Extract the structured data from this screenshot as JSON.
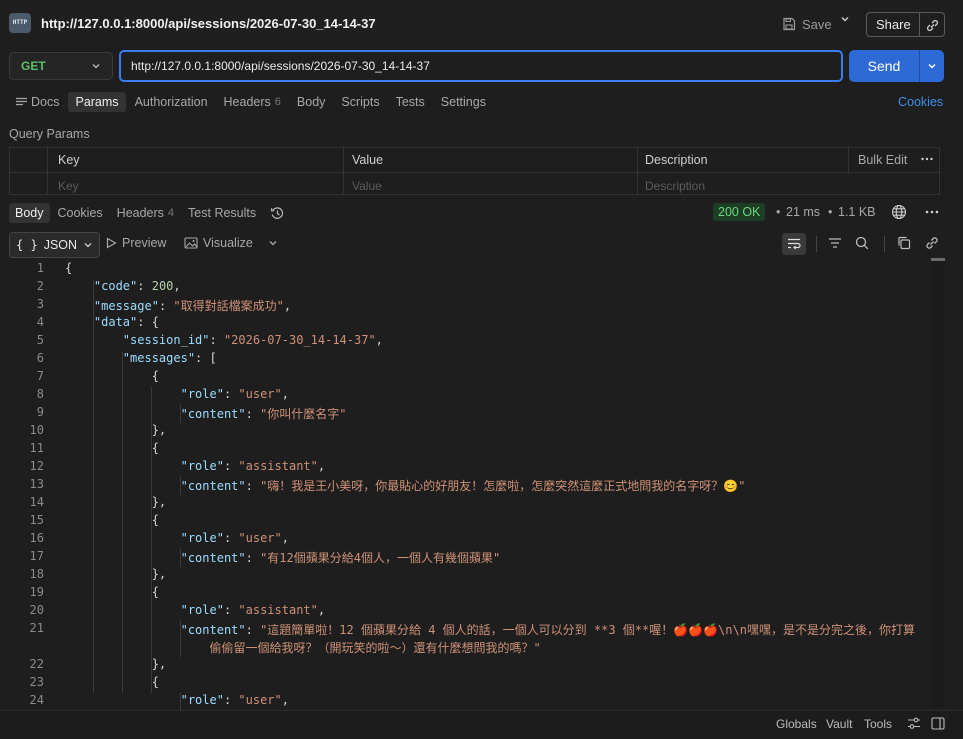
{
  "header": {
    "request_title": "http://127.0.0.1:8000/api/sessions/2026-07-30_14-14-37",
    "http_badge": "HTTP",
    "save_label": "Save",
    "share_label": "Share"
  },
  "request": {
    "method": "GET",
    "url": "http://127.0.0.1:8000/api/sessions/2026-07-30_14-14-37",
    "send_label": "Send",
    "tabs": [
      {
        "label": "Docs"
      },
      {
        "label": "Params"
      },
      {
        "label": "Authorization"
      },
      {
        "label": "Headers",
        "count": "6"
      },
      {
        "label": "Body"
      },
      {
        "label": "Scripts"
      },
      {
        "label": "Tests"
      },
      {
        "label": "Settings"
      }
    ],
    "active_tab": "Params",
    "cookies_label": "Cookies",
    "query_params_title": "Query Params",
    "table": {
      "headers": [
        "Key",
        "Value",
        "Description"
      ],
      "bulk_edit": "Bulk Edit",
      "placeholders": [
        "Key",
        "Value",
        "Description"
      ]
    }
  },
  "response": {
    "tabs": [
      {
        "label": "Body"
      },
      {
        "label": "Cookies"
      },
      {
        "label": "Headers",
        "count": "4"
      },
      {
        "label": "Test Results"
      }
    ],
    "active_tab": "Body",
    "status": "200 OK",
    "time": "21 ms",
    "size": "1.1 KB",
    "format": "JSON",
    "preview_label": "Preview",
    "visualize_label": "Visualize",
    "lines": [
      {
        "n": "1",
        "t": [
          [
            "p",
            "{"
          ]
        ]
      },
      {
        "n": "2",
        "t": [
          [
            "p",
            "    "
          ],
          [
            "k",
            "\"code\""
          ],
          [
            "p",
            ": "
          ],
          [
            "n",
            "200"
          ],
          [
            "p",
            ","
          ]
        ]
      },
      {
        "n": "3",
        "t": [
          [
            "p",
            "    "
          ],
          [
            "k",
            "\"message\""
          ],
          [
            "p",
            ": "
          ],
          [
            "s",
            "\"取得對話檔案成功\""
          ],
          [
            "p",
            ","
          ]
        ]
      },
      {
        "n": "4",
        "t": [
          [
            "p",
            "    "
          ],
          [
            "k",
            "\"data\""
          ],
          [
            "p",
            ": {"
          ]
        ]
      },
      {
        "n": "5",
        "t": [
          [
            "p",
            "        "
          ],
          [
            "k",
            "\"session_id\""
          ],
          [
            "p",
            ": "
          ],
          [
            "s",
            "\"2026-07-30_14-14-37\""
          ],
          [
            "p",
            ","
          ]
        ]
      },
      {
        "n": "6",
        "t": [
          [
            "p",
            "        "
          ],
          [
            "k",
            "\"messages\""
          ],
          [
            "p",
            ": ["
          ]
        ]
      },
      {
        "n": "7",
        "t": [
          [
            "p",
            "            {"
          ]
        ]
      },
      {
        "n": "8",
        "t": [
          [
            "p",
            "                "
          ],
          [
            "k",
            "\"role\""
          ],
          [
            "p",
            ": "
          ],
          [
            "s",
            "\"user\""
          ],
          [
            "p",
            ","
          ]
        ]
      },
      {
        "n": "9",
        "t": [
          [
            "p",
            "                "
          ],
          [
            "k",
            "\"content\""
          ],
          [
            "p",
            ": "
          ],
          [
            "s",
            "\"你叫什麼名字\""
          ]
        ]
      },
      {
        "n": "10",
        "t": [
          [
            "p",
            "            },"
          ]
        ]
      },
      {
        "n": "11",
        "t": [
          [
            "p",
            "            {"
          ]
        ]
      },
      {
        "n": "12",
        "t": [
          [
            "p",
            "                "
          ],
          [
            "k",
            "\"role\""
          ],
          [
            "p",
            ": "
          ],
          [
            "s",
            "\"assistant\""
          ],
          [
            "p",
            ","
          ]
        ]
      },
      {
        "n": "13",
        "t": [
          [
            "p",
            "                "
          ],
          [
            "k",
            "\"content\""
          ],
          [
            "p",
            ": "
          ],
          [
            "s",
            "\"嗨！我是王小美呀，你最貼心的好朋友！怎麼啦，怎麼突然這麼正式地問我的名字呀？😊\""
          ]
        ]
      },
      {
        "n": "14",
        "t": [
          [
            "p",
            "            },"
          ]
        ]
      },
      {
        "n": "15",
        "t": [
          [
            "p",
            "            {"
          ]
        ]
      },
      {
        "n": "16",
        "t": [
          [
            "p",
            "                "
          ],
          [
            "k",
            "\"role\""
          ],
          [
            "p",
            ": "
          ],
          [
            "s",
            "\"user\""
          ],
          [
            "p",
            ","
          ]
        ]
      },
      {
        "n": "17",
        "t": [
          [
            "p",
            "                "
          ],
          [
            "k",
            "\"content\""
          ],
          [
            "p",
            ": "
          ],
          [
            "s",
            "\"有12個蘋果分給4個人，一個人有幾個蘋果\""
          ]
        ]
      },
      {
        "n": "18",
        "t": [
          [
            "p",
            "            },"
          ]
        ]
      },
      {
        "n": "19",
        "t": [
          [
            "p",
            "            {"
          ]
        ]
      },
      {
        "n": "20",
        "t": [
          [
            "p",
            "                "
          ],
          [
            "k",
            "\"role\""
          ],
          [
            "p",
            ": "
          ],
          [
            "s",
            "\"assistant\""
          ],
          [
            "p",
            ","
          ]
        ]
      },
      {
        "n": "21",
        "t": [
          [
            "p",
            "                "
          ],
          [
            "k",
            "\"content\""
          ],
          [
            "p",
            ": "
          ],
          [
            "s",
            "\"這題簡單啦！12 個蘋果分給 4 個人的話，一個人可以分到 **3 個**喔！🍎🍎🍎\\n\\n嘿嘿，是不是分完之後，你打算"
          ]
        ]
      },
      {
        "n": "",
        "t": [
          [
            "p",
            "                    "
          ],
          [
            "s",
            "偷偷留一個給我呀？（開玩笑的啦～）還有什麼想問我的嗎？\""
          ]
        ]
      },
      {
        "n": "22",
        "t": [
          [
            "p",
            "            },"
          ]
        ]
      },
      {
        "n": "23",
        "t": [
          [
            "p",
            "            {"
          ]
        ]
      },
      {
        "n": "24",
        "t": [
          [
            "p",
            "                "
          ],
          [
            "k",
            "\"role\""
          ],
          [
            "p",
            ": "
          ],
          [
            "s",
            "\"user\""
          ],
          [
            "p",
            ","
          ]
        ]
      }
    ]
  },
  "footer": {
    "globals": "Globals",
    "vault": "Vault",
    "tools": "Tools"
  },
  "colors": {
    "accent": "#3b7cf5",
    "send": "#2e6ad6",
    "method_get": "#5cbf6b",
    "status_ok": "#6fd582",
    "json_key": "#9cdcfe",
    "json_string": "#ce9178",
    "json_number": "#b5cea8"
  }
}
